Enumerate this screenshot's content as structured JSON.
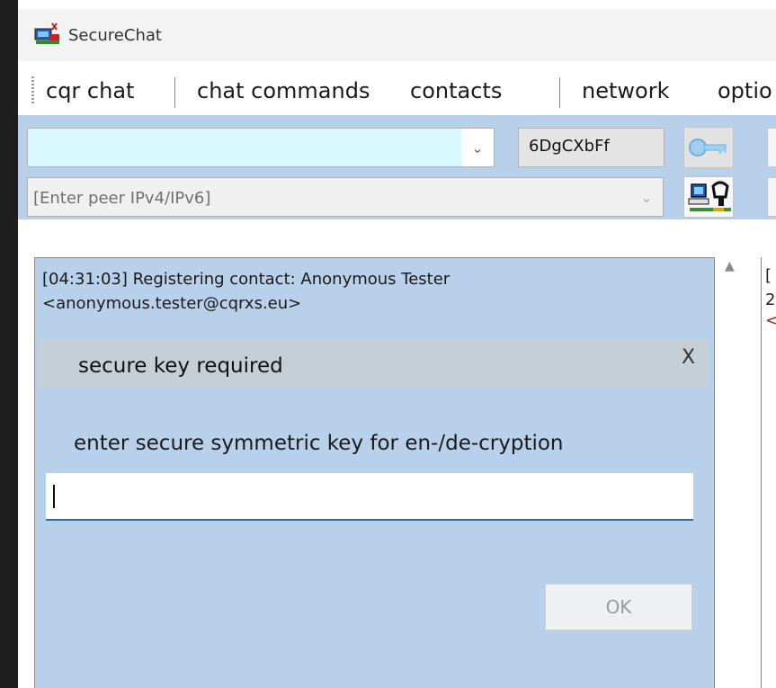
{
  "window": {
    "title": "SecureChat",
    "icon": "securechat-app-icon"
  },
  "menu": {
    "items": [
      {
        "label": "cqr chat"
      },
      {
        "label": "chat commands"
      },
      {
        "label": "contacts"
      },
      {
        "label": "network"
      },
      {
        "label": "optio"
      }
    ]
  },
  "toolbar": {
    "key_combo_value": "",
    "nick_value": "6DgCXbFf",
    "peer_placeholder": "[Enter peer IPv4/IPv6]",
    "key_icon": "key-icon",
    "connect_icon": "computer-plug-icon"
  },
  "chat": {
    "log_lines": [
      "[04:31:03] Registering contact: Anonymous Tester",
      "<anonymous.tester@cqrxs.eu>"
    ],
    "side_peek": [
      "[",
      "2",
      "<"
    ]
  },
  "dialog": {
    "title": "secure key required",
    "close_label": "X",
    "prompt": "enter secure symmetric key for en-/de-cryption",
    "input_value": "",
    "ok_label": "OK"
  },
  "colors": {
    "panel_blue": "#b8d0ea",
    "key_combo_bg": "#d8f8fb",
    "focus_underline": "#2b6cb0"
  }
}
